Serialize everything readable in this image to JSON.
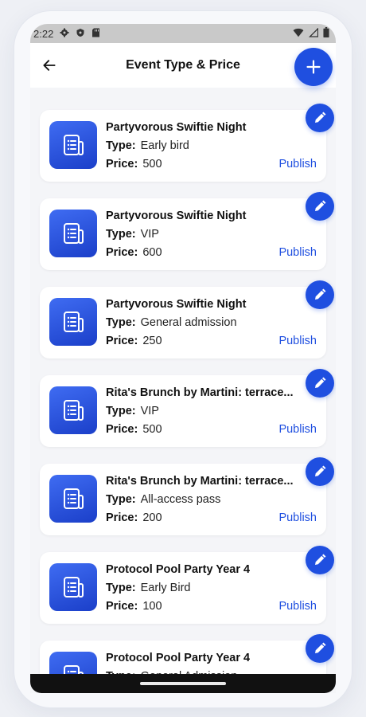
{
  "status_bar": {
    "time": "2:22"
  },
  "header": {
    "title": "Event Type & Price"
  },
  "labels": {
    "type_label": "Type:",
    "price_label": "Price:",
    "publish_label": "Publish"
  },
  "events": [
    {
      "title": "Partyvorous Swiftie Night",
      "type": "Early bird",
      "price": "500"
    },
    {
      "title": "Partyvorous Swiftie Night",
      "type": "VIP",
      "price": "600"
    },
    {
      "title": "Partyvorous Swiftie Night",
      "type": "General admission",
      "price": "250"
    },
    {
      "title": "Rita's Brunch by Martini: terrace...",
      "type": "VIP",
      "price": "500"
    },
    {
      "title": "Rita's Brunch by Martini: terrace...",
      "type": "All-access pass",
      "price": "200"
    },
    {
      "title": "Protocol Pool Party Year 4",
      "type": "Early Bird",
      "price": "100"
    },
    {
      "title": "Protocol Pool Party Year 4",
      "type": "General Admission",
      "price": ""
    }
  ],
  "colors": {
    "accent": "#1f4fe0",
    "background": "#f4f5f8",
    "card": "#ffffff"
  },
  "icons": {
    "back": "arrow-left-icon",
    "add": "plus-icon",
    "edit": "pencil-icon",
    "thumb": "document-list-icon"
  }
}
